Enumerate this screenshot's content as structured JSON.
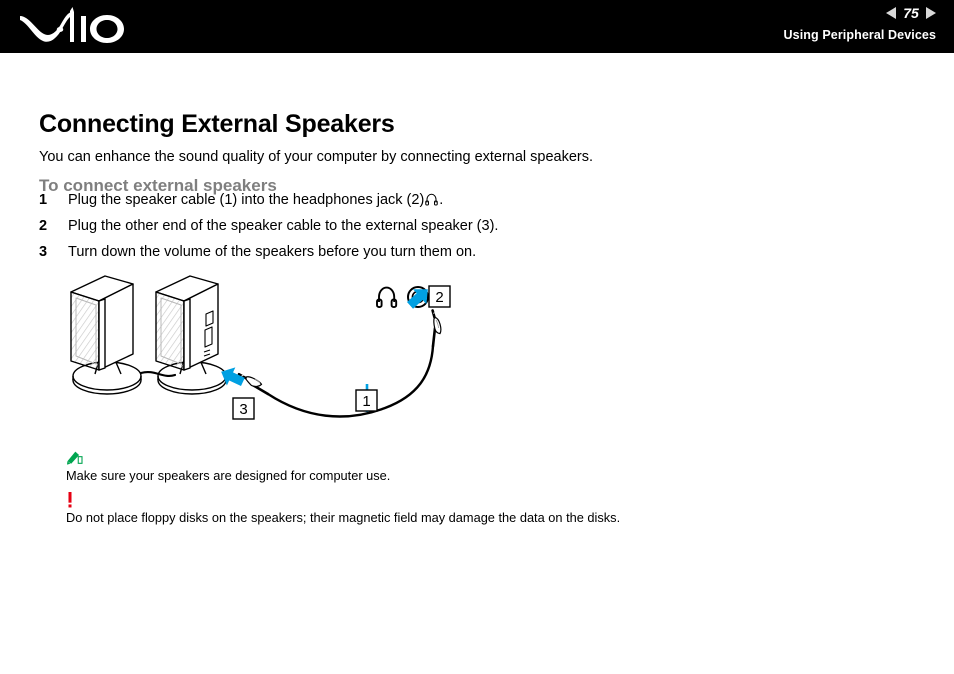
{
  "header": {
    "logo_name": "vaio-logo",
    "page_number": "75",
    "prev_arrow": "◀",
    "next_arrow": "▶",
    "section_label": "Using Peripheral Devices",
    "bar_color": "#000000"
  },
  "document": {
    "title": "Connecting External Speakers",
    "intro": "You can enhance the sound quality of your computer by connecting external speakers.",
    "subheading": "To connect external speakers",
    "steps": [
      {
        "num": "1",
        "text_before": "Plug the speaker cable (1) into the headphones jack (2)",
        "text_after": "."
      },
      {
        "num": "2",
        "text_before": "Plug the other end of the speaker cable to the external speaker (3).",
        "text_after": ""
      },
      {
        "num": "3",
        "text_before": "Turn down the volume of the speakers before you turn them on.",
        "text_after": ""
      }
    ]
  },
  "diagram": {
    "name": "external-speakers-connection-diagram",
    "callouts": [
      {
        "label": "1",
        "meaning": "speaker cable"
      },
      {
        "label": "2",
        "meaning": "headphones jack"
      },
      {
        "label": "3",
        "meaning": "external speaker input"
      }
    ],
    "headphone_symbol": "headphones-icon",
    "jack_port": "audio-jack-port",
    "arrow_color": "#00A0E2",
    "speaker_count": 2
  },
  "notes": [
    {
      "icon": "note-pencil-icon",
      "icon_color": "#00a550",
      "text": "Make sure your speakers are designed for computer use."
    },
    {
      "icon": "warning-exclamation-icon",
      "icon_color": "#e60012",
      "text": "Do not place floppy disks on the speakers; their magnetic field may damage the data on the disks."
    }
  ]
}
